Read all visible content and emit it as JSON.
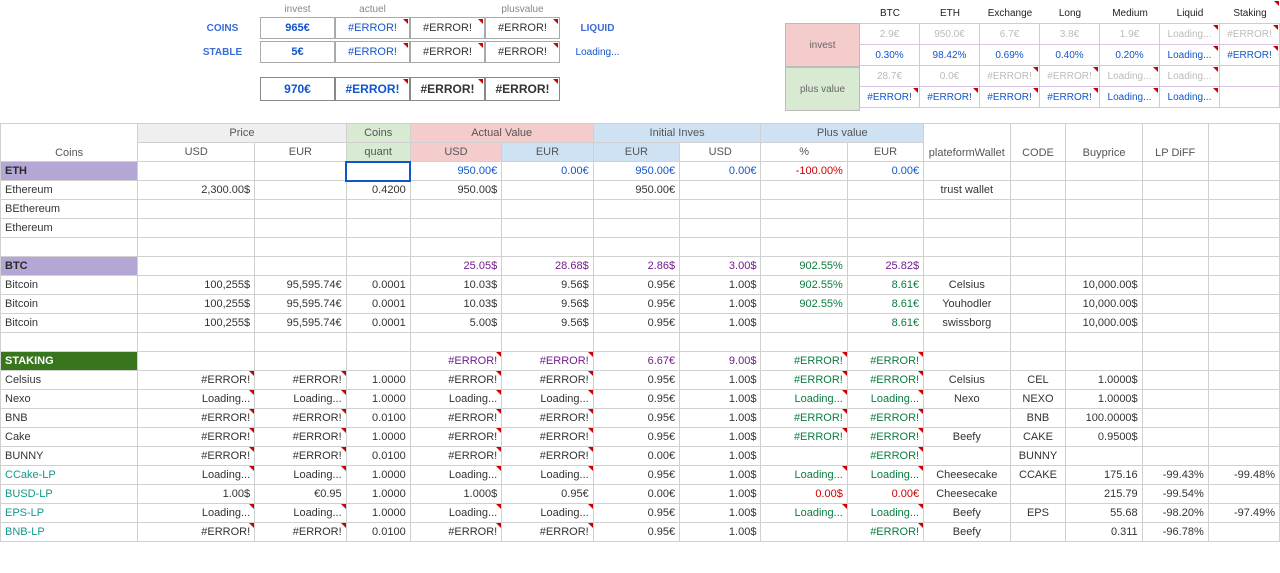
{
  "top_left": {
    "head": [
      "invest",
      "actuel",
      "",
      "plusvalue"
    ],
    "coins_label": "COINS",
    "stable_label": "STABLE",
    "coins_row": [
      "965€",
      "#ERROR!",
      "#ERROR!",
      "#ERROR!"
    ],
    "stable_row": [
      "5€",
      "#ERROR!",
      "#ERROR!",
      "#ERROR!"
    ],
    "liquid_a": "LIQUID",
    "liquid_b": "Loading...",
    "total_row": [
      "970€",
      "#ERROR!",
      "#ERROR!",
      "#ERROR!"
    ]
  },
  "top_right": {
    "head": [
      "BTC",
      "ETH",
      "Exchange",
      "Long",
      "Medium",
      "Liquid",
      "Staking"
    ],
    "invest_label": "invest",
    "pv_label": "plus value",
    "rows": [
      [
        {
          "v": "2.9€",
          "c": "grey"
        },
        {
          "v": "950.0€",
          "c": "grey"
        },
        {
          "v": "6.7€",
          "c": "grey"
        },
        {
          "v": "3.8€",
          "c": "grey"
        },
        {
          "v": "1.9€",
          "c": "grey"
        },
        {
          "v": "Loading...",
          "c": "grey",
          "tri": 1
        },
        {
          "v": "#ERROR!",
          "c": "grey",
          "tri": 1
        }
      ],
      [
        {
          "v": "0.30%",
          "c": "blue"
        },
        {
          "v": "98.42%",
          "c": "blue"
        },
        {
          "v": "0.69%",
          "c": "blue"
        },
        {
          "v": "0.40%",
          "c": "blue"
        },
        {
          "v": "0.20%",
          "c": "blue"
        },
        {
          "v": "Loading...",
          "c": "blue",
          "tri": 1
        },
        {
          "v": "#ERROR!",
          "c": "blue",
          "tri": 1
        }
      ],
      [
        {
          "v": "28.7€",
          "c": "grey"
        },
        {
          "v": "0.0€",
          "c": "grey"
        },
        {
          "v": "#ERROR!",
          "c": "grey",
          "tri": 1
        },
        {
          "v": "#ERROR!",
          "c": "grey",
          "tri": 1
        },
        {
          "v": "Loading...",
          "c": "grey",
          "tri": 1
        },
        {
          "v": "Loading...",
          "c": "grey",
          "tri": 1
        },
        {
          "v": "",
          "c": ""
        }
      ],
      [
        {
          "v": "#ERROR!",
          "c": "blue",
          "tri": 1
        },
        {
          "v": "#ERROR!",
          "c": "blue",
          "tri": 1
        },
        {
          "v": "#ERROR!",
          "c": "blue",
          "tri": 1
        },
        {
          "v": "#ERROR!",
          "c": "blue",
          "tri": 1
        },
        {
          "v": "Loading...",
          "c": "blue",
          "tri": 1
        },
        {
          "v": "Loading...",
          "c": "blue",
          "tri": 1
        },
        {
          "v": "",
          "c": ""
        }
      ]
    ]
  },
  "headers": {
    "groups": [
      "Price",
      "Coins",
      "Actual Value",
      "Initial Inves",
      "Plus value",
      "plateformWallet",
      "CODE",
      "Buyprice",
      "LP DiFF"
    ],
    "sub": [
      "Coins",
      "USD",
      "EUR",
      "quant",
      "USD",
      "EUR",
      "EUR",
      "USD",
      "%",
      "EUR"
    ]
  },
  "rows": [
    {
      "type": "section",
      "cls": "section-eth",
      "label": "ETH",
      "d": [
        "",
        "",
        "",
        "950.00€",
        "0.00€",
        "950.00€",
        "0.00€",
        "-100.00%",
        "0.00€",
        "",
        "",
        "",
        "",
        ""
      ],
      "clr": {
        "3": "blue",
        "4": "blue",
        "5": "blue",
        "6": "blue",
        "7": "red",
        "8": "blue"
      }
    },
    {
      "type": "row",
      "label": "Ethereum",
      "d": [
        "2,300.00$",
        "",
        "0.4200",
        "950.00$",
        "",
        "950.00€",
        "",
        "",
        "",
        "trust wallet",
        "",
        "",
        "",
        ""
      ]
    },
    {
      "type": "row",
      "label": "BEthereum",
      "d": [
        "",
        "",
        "",
        "",
        "",
        "",
        "",
        "",
        "",
        "",
        "",
        "",
        "",
        ""
      ]
    },
    {
      "type": "row",
      "label": "Ethereum",
      "d": [
        "",
        "",
        "",
        "",
        "",
        "",
        "",
        "",
        "",
        "",
        "",
        "",
        "",
        ""
      ]
    },
    {
      "type": "blank"
    },
    {
      "type": "section",
      "cls": "section-btc",
      "label": "BTC",
      "d": [
        "",
        "",
        "",
        "25.05$",
        "28.68$",
        "2.86$",
        "3.00$",
        "902.55%",
        "25.82$",
        "",
        "",
        "",
        "",
        ""
      ],
      "clr": {
        "3": "purple",
        "4": "purple",
        "5": "purple",
        "6": "purple",
        "7": "green",
        "8": "purple"
      }
    },
    {
      "type": "row",
      "label": "Bitcoin",
      "d": [
        "100,255$",
        "95,595.74€",
        "0.0001",
        "10.03$",
        "9.56$",
        "0.95€",
        "1.00$",
        "902.55%",
        "8.61€",
        "Celsius",
        "",
        "10,000.00$",
        "",
        ""
      ],
      "clr": {
        "7": "green",
        "8": "green"
      }
    },
    {
      "type": "row",
      "label": "Bitcoin",
      "d": [
        "100,255$",
        "95,595.74€",
        "0.0001",
        "10.03$",
        "9.56$",
        "0.95€",
        "1.00$",
        "902.55%",
        "8.61€",
        "Youhodler",
        "",
        "10,000.00$",
        "",
        ""
      ],
      "clr": {
        "7": "green",
        "8": "green"
      }
    },
    {
      "type": "row",
      "label": "Bitcoin",
      "d": [
        "100,255$",
        "95,595.74€",
        "0.0001",
        "5.00$",
        "9.56$",
        "0.95€",
        "1.00$",
        "",
        "8.61€",
        "swissborg",
        "",
        "10,000.00$",
        "",
        ""
      ],
      "clr": {
        "8": "green"
      }
    },
    {
      "type": "blank"
    },
    {
      "type": "section",
      "cls": "section-stk",
      "label": "STAKING",
      "d": [
        "",
        "",
        "",
        "#ERROR!",
        "#ERROR!",
        "6.67€",
        "9.00$",
        "#ERROR!",
        "#ERROR!",
        "",
        "",
        "",
        "",
        ""
      ],
      "clr": {
        "3": "purple",
        "4": "purple",
        "5": "purple",
        "6": "purple",
        "7": "green",
        "8": "green"
      },
      "tri": [
        3,
        4,
        7,
        8
      ]
    },
    {
      "type": "row",
      "label": "Celsius",
      "d": [
        "#ERROR!",
        "#ERROR!",
        "1.0000",
        "#ERROR!",
        "#ERROR!",
        "0.95€",
        "1.00$",
        "#ERROR!",
        "#ERROR!",
        "Celsius",
        "CEL",
        "1.0000$",
        "",
        ""
      ],
      "clr": {
        "7": "green",
        "8": "green"
      },
      "tri": [
        0,
        1,
        3,
        4,
        7,
        8
      ]
    },
    {
      "type": "row",
      "label": "Nexo",
      "d": [
        "Loading...",
        "Loading...",
        "1.0000",
        "Loading...",
        "Loading...",
        "0.95€",
        "1.00$",
        "Loading...",
        "Loading...",
        "Nexo",
        "NEXO",
        "1.0000$",
        "",
        ""
      ],
      "clr": {
        "7": "green",
        "8": "green"
      },
      "tri": [
        0,
        1,
        3,
        4,
        7,
        8
      ]
    },
    {
      "type": "row",
      "label": "BNB",
      "d": [
        "#ERROR!",
        "#ERROR!",
        "0.0100",
        "#ERROR!",
        "#ERROR!",
        "0.95€",
        "1.00$",
        "#ERROR!",
        "#ERROR!",
        "",
        "BNB",
        "100.0000$",
        "",
        ""
      ],
      "clr": {
        "7": "green",
        "8": "green"
      },
      "tri": [
        0,
        1,
        3,
        4,
        7,
        8
      ]
    },
    {
      "type": "row",
      "label": "Cake",
      "d": [
        "#ERROR!",
        "#ERROR!",
        "1.0000",
        "#ERROR!",
        "#ERROR!",
        "0.95€",
        "1.00$",
        "#ERROR!",
        "#ERROR!",
        "Beefy",
        "CAKE",
        "0.9500$",
        "",
        ""
      ],
      "clr": {
        "7": "green",
        "8": "green"
      },
      "tri": [
        0,
        1,
        3,
        4,
        7,
        8
      ]
    },
    {
      "type": "row",
      "label": "BUNNY",
      "d": [
        "#ERROR!",
        "#ERROR!",
        "0.0100",
        "#ERROR!",
        "#ERROR!",
        "0.00€",
        "1.00$",
        "",
        "#ERROR!",
        "",
        "BUNNY",
        "",
        "",
        ""
      ],
      "clr": {
        "8": "green"
      },
      "tri": [
        0,
        1,
        3,
        4,
        8
      ]
    },
    {
      "type": "row",
      "label": "CCake-LP",
      "lblclr": "teal",
      "d": [
        "Loading...",
        "Loading...",
        "1.0000",
        "Loading...",
        "Loading...",
        "0.95€",
        "1.00$",
        "Loading...",
        "Loading...",
        "Cheesecake",
        "CCAKE",
        "175.16",
        "-99.43%",
        "-99.48%"
      ],
      "clr": {
        "7": "green",
        "8": "green"
      },
      "tri": [
        0,
        1,
        3,
        4,
        7,
        8
      ]
    },
    {
      "type": "row",
      "label": "BUSD-LP",
      "lblclr": "teal",
      "d": [
        "1.00$",
        "€0.95",
        "1.0000",
        "1.000$",
        "0.95€",
        "0.00€",
        "1.00$",
        "0.00$",
        "0.00€",
        "Cheesecake",
        "",
        "215.79",
        "-99.54%",
        "",
        ""
      ],
      "clr": {
        "7": "red",
        "8": "red"
      }
    },
    {
      "type": "row",
      "label": "EPS-LP",
      "lblclr": "teal",
      "d": [
        "Loading...",
        "Loading...",
        "1.0000",
        "Loading...",
        "Loading...",
        "0.95€",
        "1.00$",
        "Loading...",
        "Loading...",
        "Beefy",
        "EPS",
        "55.68",
        "-98.20%",
        "-97.49%"
      ],
      "clr": {
        "7": "green",
        "8": "green"
      },
      "tri": [
        0,
        1,
        3,
        4,
        7,
        8
      ]
    },
    {
      "type": "row",
      "label": "BNB-LP",
      "lblclr": "teal",
      "d": [
        "#ERROR!",
        "#ERROR!",
        "0.0100",
        "#ERROR!",
        "#ERROR!",
        "0.95€",
        "1.00$",
        "",
        "#ERROR!",
        "Beefy",
        "",
        "0.311",
        "-96.78%",
        "",
        ""
      ],
      "clr": {
        "8": "green"
      },
      "tri": [
        0,
        1,
        3,
        4,
        8
      ]
    }
  ]
}
